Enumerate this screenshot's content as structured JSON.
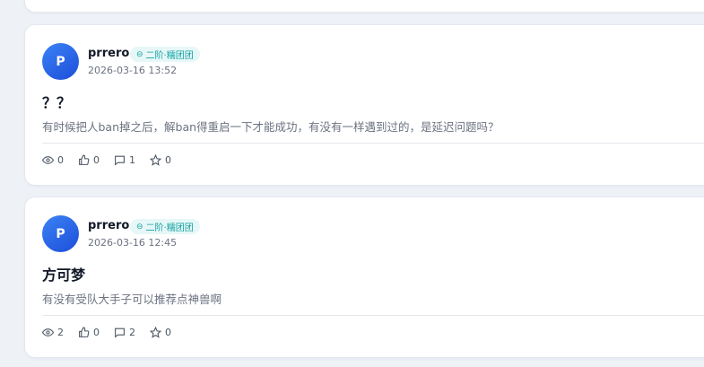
{
  "posts": [
    {
      "avatar_letter": "P",
      "username": "prrero",
      "badge": "二阶·糯团团",
      "badge_icon": "⊖",
      "timestamp": "2026-03-16 13:52",
      "title": "？？",
      "excerpt": "有时候把人ban掉之后，解ban得重启一下才能成功，有没有一样遇到过的，是延迟问题吗？",
      "views": "0",
      "likes": "0",
      "comments": "1",
      "favorites": "0"
    },
    {
      "avatar_letter": "P",
      "username": "prrero",
      "badge": "二阶·糯团团",
      "badge_icon": "⊖",
      "timestamp": "2026-03-16 12:45",
      "title": "方可梦",
      "excerpt": "有没有受队大手子可以推荐点神兽啊",
      "views": "2",
      "likes": "0",
      "comments": "2",
      "favorites": "0"
    }
  ],
  "colors": {
    "avatar": "#2563eb",
    "badge_bg": "#e7f7f7",
    "badge_text": "#14a3a3",
    "page_bg": "#eef2f7"
  },
  "icons": [
    "eye-icon",
    "thumbs-up-icon",
    "comment-icon",
    "star-icon"
  ]
}
